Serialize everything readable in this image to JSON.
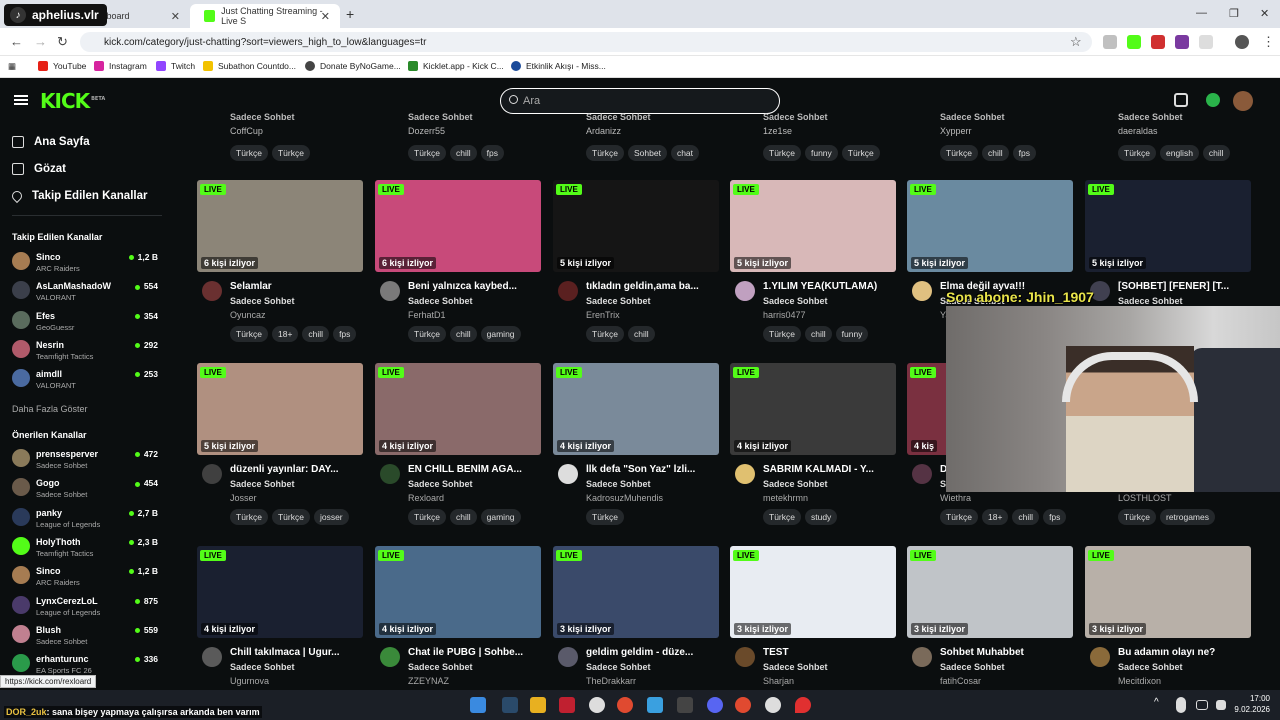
{
  "browser": {
    "tabs": [
      {
        "label": "ashboard",
        "active": false
      },
      {
        "label": "Just Chatting Streaming - Live S",
        "active": true
      }
    ],
    "url": "kick.com/category/just-chatting?sort=viewers_high_to_low&languages=tr",
    "bookmarks": [
      "YouTube",
      "Instagram",
      "Twitch",
      "Subathon Countdo...",
      "Donate ByNoGame...",
      "Kicklet.app - Kick C...",
      "Etkinlik Akışı - Miss..."
    ],
    "status_url": "https://kick.com/rexloard"
  },
  "overlay": {
    "streamer_handle": "aphelius.vlr",
    "sub_text": "Son abone: Jhin_1907",
    "chat": [
      {
        "user": "ryugfsth",
        "text": ":"
      },
      {
        "user": "DOR_2uk",
        "text": ": sana bişey yapmaya çalışırsa arkanda ben varım"
      }
    ]
  },
  "header": {
    "logo": "KICK",
    "logo_badge": "BETA",
    "search_placeholder": "Ara"
  },
  "sidebar": {
    "nav": [
      "Ana Sayfa",
      "Gözat",
      "Takip Edilen Kanallar"
    ],
    "followed_title": "Takip Edilen Kanallar",
    "followed": [
      {
        "name": "Sinco",
        "game": "ARC Raiders",
        "viewers": "1,2 B",
        "color": "#a67c52"
      },
      {
        "name": "AsLanMashadoW",
        "game": "VALORANT",
        "viewers": "554",
        "color": "#3b3f4a"
      },
      {
        "name": "Efes",
        "game": "GeoGuessr",
        "viewers": "354",
        "color": "#5a6b5d"
      },
      {
        "name": "Nesrin",
        "game": "Teamfight Tactics",
        "viewers": "292",
        "color": "#b05a6a"
      },
      {
        "name": "aimdll",
        "game": "VALORANT",
        "viewers": "253",
        "color": "#4a6aa0"
      }
    ],
    "show_more": "Daha Fazla Göster",
    "recommended_title": "Önerilen Kanallar",
    "recommended": [
      {
        "name": "prensesperver",
        "game": "Sadece Sohbet",
        "viewers": "472",
        "color": "#8a7a5a"
      },
      {
        "name": "Gogo",
        "game": "Sadece Sohbet",
        "viewers": "454",
        "color": "#6a5a4a"
      },
      {
        "name": "panky",
        "game": "League of Legends",
        "viewers": "2,7 B",
        "color": "#2a3a5a"
      },
      {
        "name": "HolyThoth",
        "game": "Teamfight Tactics",
        "viewers": "2,3 B",
        "color": "#53fc18"
      },
      {
        "name": "Sinco",
        "game": "ARC Raiders",
        "viewers": "1,2 B",
        "color": "#a67c52"
      },
      {
        "name": "LynxCerezLoL",
        "game": "League of Legends",
        "viewers": "875",
        "color": "#4a3a6a"
      },
      {
        "name": "Blush",
        "game": "Sadece Sohbet",
        "viewers": "559",
        "color": "#c08090"
      },
      {
        "name": "erhanturunc",
        "game": "EA Sports FC 26",
        "viewers": "336",
        "color": "#2a9a4a"
      }
    ]
  },
  "top_row": [
    {
      "cat": "Sadece Sohbet",
      "user": "CoffCup",
      "tags": [
        "Türkçe",
        "Türkçe"
      ]
    },
    {
      "cat": "Sadece Sohbet",
      "user": "Dozerr55",
      "tags": [
        "Türkçe",
        "chill",
        "fps"
      ]
    },
    {
      "cat": "Sadece Sohbet",
      "user": "Ardanizz",
      "tags": [
        "Türkçe",
        "Sohbet",
        "chat"
      ]
    },
    {
      "cat": "Sadece Sohbet",
      "user": "1ze1se",
      "tags": [
        "Türkçe",
        "funny",
        "Türkçe"
      ]
    },
    {
      "cat": "Sadece Sohbet",
      "user": "Xypperr",
      "tags": [
        "Türkçe",
        "chill",
        "fps"
      ]
    },
    {
      "cat": "Sadece Sohbet",
      "user": "daeraldas",
      "tags": [
        "Türkçe",
        "english",
        "chill"
      ]
    }
  ],
  "cards": [
    [
      {
        "live": "LIVE",
        "viewers": "6 kişi izliyor",
        "title": "Selamlar",
        "cat": "Sadece Sohbet",
        "user": "Oyuncaz",
        "tags": [
          "Türkçe",
          "18+",
          "chill",
          "fps"
        ],
        "bg": "#8c8578",
        "av": "#6a3030"
      },
      {
        "live": "LIVE",
        "viewers": "6 kişi izliyor",
        "title": "Beni yalnızca kaybed...",
        "cat": "Sadece Sohbet",
        "user": "FerhatD1",
        "tags": [
          "Türkçe",
          "chill",
          "gaming"
        ],
        "bg": "#c84a7a",
        "av": "#7a7a7a"
      },
      {
        "live": "LIVE",
        "viewers": "5 kişi izliyor",
        "title": "tıkladın geldin,ama ba...",
        "cat": "Sadece Sohbet",
        "user": "ErenTrix",
        "tags": [
          "Türkçe",
          "chill"
        ],
        "bg": "#151515",
        "av": "#5a2020"
      },
      {
        "live": "LIVE",
        "viewers": "5 kişi izliyor",
        "title": "1.YILIM YEA(KUTLAMA)",
        "cat": "Sadece Sohbet",
        "user": "harris0477",
        "tags": [
          "Türkçe",
          "chill",
          "funny"
        ],
        "bg": "#d8b8b8",
        "av": "#c0a0c0"
      },
      {
        "live": "LIVE",
        "viewers": "5 kişi izliyor",
        "title": "Elma değil ayva!!!",
        "cat": "Sadece Sohbet",
        "user": "Ya",
        "tags": [],
        "bg": "#6a8aa0",
        "av": "#e0c080"
      },
      {
        "live": "LIVE",
        "viewers": "5 kişi izliyor",
        "title": "[SOHBET] [FENER] [T...",
        "cat": "Sadece Sohbet",
        "user": "",
        "tags": [],
        "bg": "#1a2030",
        "av": "#404050"
      }
    ],
    [
      {
        "live": "LIVE",
        "viewers": "5 kişi izliyor",
        "title": "düzenli yayınlar: DAY...",
        "cat": "Sadece Sohbet",
        "user": "Josser",
        "tags": [
          "Türkçe",
          "Türkçe",
          "josser"
        ],
        "bg": "#b09080",
        "av": "#404040"
      },
      {
        "live": "LIVE",
        "viewers": "4 kişi izliyor",
        "title": "EN CHİLL BENİM AGA...",
        "cat": "Sadece Sohbet",
        "user": "Rexloard",
        "tags": [
          "Türkçe",
          "chill",
          "gaming"
        ],
        "bg": "#8a6a6a",
        "av": "#2a4a2a"
      },
      {
        "live": "LIVE",
        "viewers": "4 kişi izliyor",
        "title": "İlk defa \"Son Yaz\" İzli...",
        "cat": "Sadece Sohbet",
        "user": "KadrosuzMuhendis",
        "tags": [
          "Türkçe"
        ],
        "bg": "#7a8a9a",
        "av": "#dddddd"
      },
      {
        "live": "LIVE",
        "viewers": "4 kişi izliyor",
        "title": "SABRIM KALMADI - Y...",
        "cat": "Sadece Sohbet",
        "user": "metekhrmn",
        "tags": [
          "Türkçe",
          "study"
        ],
        "bg": "#3a3a3a",
        "av": "#e0c070"
      },
      {
        "live": "LIVE",
        "viewers": "4 kiş",
        "title": "D",
        "cat": "Sadece Sohbet",
        "user": "Wiethra",
        "tags": [
          "Türkçe",
          "18+",
          "chill",
          "fps"
        ],
        "bg": "#7a3040",
        "av": "#553344"
      },
      {
        "live": "",
        "viewers": "",
        "title": "",
        "cat": "",
        "user": "LOSTHLOST",
        "tags": [
          "Türkçe",
          "retrogames"
        ],
        "bg": "#0b0e0f",
        "av": "#0b0e0f"
      }
    ],
    [
      {
        "live": "LIVE",
        "viewers": "4 kişi izliyor",
        "title": "Chill takılmaca | Ugur...",
        "cat": "Sadece Sohbet",
        "user": "Ugurnova",
        "tags": [],
        "bg": "#1a2030",
        "av": "#5a5a5a"
      },
      {
        "live": "LIVE",
        "viewers": "4 kişi izliyor",
        "title": "Chat ile PUBG | Sohbe...",
        "cat": "Sadece Sohbet",
        "user": "ZZEYNAZ",
        "tags": [],
        "bg": "#4a6a8a",
        "av": "#3a8a3a"
      },
      {
        "live": "LIVE",
        "viewers": "3 kişi izliyor",
        "title": "geldim geldim - düze...",
        "cat": "Sadece Sohbet",
        "user": "TheDrakkarr",
        "tags": [],
        "bg": "#3a4a6a",
        "av": "#5a5a6a"
      },
      {
        "live": "LIVE",
        "viewers": "3 kişi izliyor",
        "title": "TEST",
        "cat": "Sadece Sohbet",
        "user": "Sharjan",
        "tags": [],
        "bg": "#e8ecf2",
        "av": "#6a4a2a"
      },
      {
        "live": "LIVE",
        "viewers": "3 kişi izliyor",
        "title": "Sohbet Muhabbet",
        "cat": "Sadece Sohbet",
        "user": "fatihCosar",
        "tags": [],
        "bg": "#c0c4c8",
        "av": "#7a6a5a"
      },
      {
        "live": "LIVE",
        "viewers": "3 kişi izliyor",
        "title": "Bu adamın olayı ne?",
        "cat": "Sadece Sohbet",
        "user": "Mecitdixon",
        "tags": [],
        "bg": "#b8b0a8",
        "av": "#8a6a3a"
      }
    ]
  ],
  "taskbar": {
    "time": "17:00",
    "date": "9.02.2026"
  }
}
